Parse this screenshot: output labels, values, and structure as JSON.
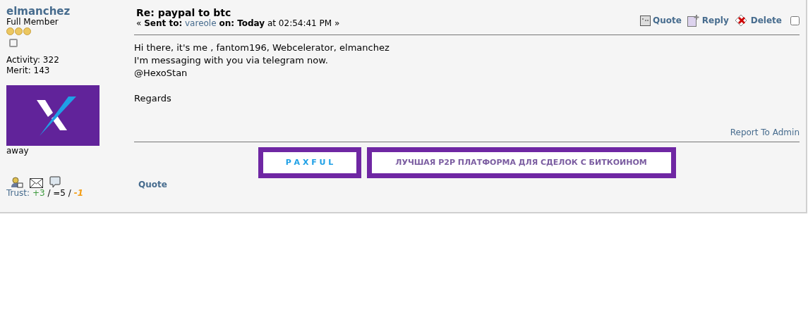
{
  "author": {
    "name": "elmanchez",
    "rank": "Full Member",
    "coins": [
      {
        "kind": "coin"
      },
      {
        "kind": "coin"
      },
      {
        "kind": "coin"
      }
    ],
    "activity": "Activity: 322",
    "merit": "Merit: 143",
    "status": "away",
    "trust": {
      "label": "Trust:",
      "positive": "+3",
      "neutral": " / =5 / ",
      "negative": "-1"
    }
  },
  "message": {
    "subject": "Re: paypal to btc",
    "meta_prefix": "« ",
    "sent_to_label": "Sent to:",
    "recipient": "vareole",
    "on_label": "on:",
    "day": "Today",
    "time": " at 02:54:41 PM »",
    "actions": [
      {
        "kind": "quote",
        "label": "Quote"
      },
      {
        "kind": "reply",
        "label": "Reply"
      },
      {
        "kind": "delete",
        "label": "Delete"
      }
    ],
    "selected": false,
    "body": [
      [
        "Hi there, it's me , fantom196, Webcelerator, elmanchez",
        "I'm messaging with you via telegram now.",
        "@HexoStan"
      ],
      [
        "Regards"
      ]
    ],
    "report": "Report To Admin",
    "banners": [
      {
        "kind": "brand",
        "text": "P A X F U L"
      },
      {
        "kind": "slogan",
        "text": "ЛУЧШАЯ P2P ПЛАТФОРМА ДЛЯ СДЕЛОК С БИТКОИНОМ"
      }
    ],
    "footer_link": "Quote"
  }
}
